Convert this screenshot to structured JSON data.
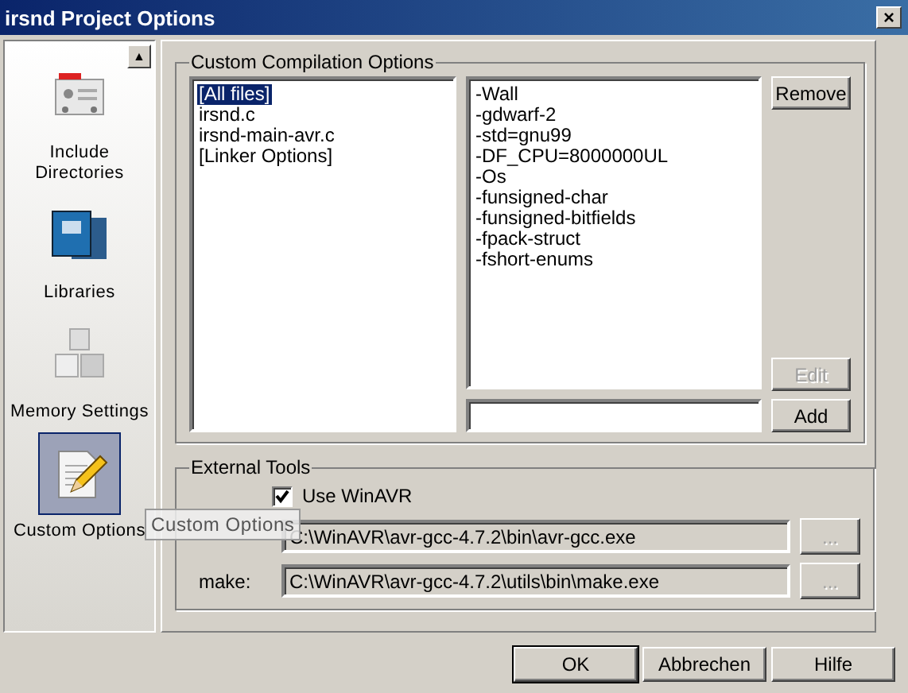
{
  "window": {
    "title": "irsnd Project Options",
    "close": "×"
  },
  "sidebar": {
    "scroll_up": "▲",
    "items": [
      {
        "label": "Include Directories",
        "kind": "include",
        "selected": false
      },
      {
        "label": "Libraries",
        "kind": "libraries",
        "selected": false
      },
      {
        "label": "Memory Settings",
        "kind": "memory",
        "selected": false
      },
      {
        "label": "Custom Options",
        "kind": "custom",
        "selected": true
      }
    ]
  },
  "tooltip": "Custom Options",
  "compilation": {
    "title": "Custom Compilation Options",
    "files": [
      {
        "label": "[All files]",
        "selected": true
      },
      {
        "label": "irsnd.c",
        "selected": false
      },
      {
        "label": "irsnd-main-avr.c",
        "selected": false
      },
      {
        "label": "[Linker Options]",
        "selected": false
      }
    ],
    "options": [
      "-Wall",
      "-gdwarf-2",
      "-std=gnu99",
      "-DF_CPU=8000000UL",
      "-Os",
      "-funsigned-char",
      "-funsigned-bitfields",
      "-fpack-struct",
      "-fshort-enums"
    ],
    "buttons": [
      {
        "label": "Remove",
        "disabled": false
      },
      {
        "label": "Edit",
        "disabled": true
      },
      {
        "label": "Add",
        "disabled": false
      }
    ]
  },
  "external_tools": {
    "title": "External Tools",
    "use_winavr": {
      "label": "Use WinAVR",
      "checked": true
    },
    "tools": [
      {
        "value": "C:\\WinAVR\\avr-gcc-4.7.2\\bin\\avr-gcc.exe",
        "browse": "...",
        "browse_disabled": true
      },
      {
        "label": "make:",
        "value": "C:\\WinAVR\\avr-gcc-4.7.2\\utils\\bin\\make.exe",
        "browse": "...",
        "browse_disabled": true
      }
    ]
  },
  "buttons": [
    "OK",
    "Abbrechen",
    "Hilfe"
  ]
}
